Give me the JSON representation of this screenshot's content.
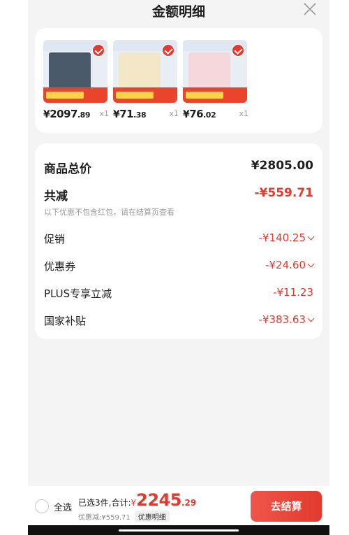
{
  "header": {
    "title": "金额明细",
    "close_icon": "close-icon"
  },
  "products": [
    {
      "price_currency": "¥",
      "price_int": "2097",
      "price_dec": ".89",
      "qty": "x1",
      "thumb_color": "#4a5a6a"
    },
    {
      "price_currency": "¥",
      "price_int": "71",
      "price_dec": ".38",
      "qty": "x1",
      "thumb_color": "#f3e7c8"
    },
    {
      "price_currency": "¥",
      "price_int": "76",
      "price_dec": ".02",
      "qty": "x1",
      "thumb_color": "#f6d8dc"
    }
  ],
  "summary": {
    "total_label": "商品总价",
    "total_value": "¥2805.00",
    "reduce_label": "共减",
    "reduce_value": "-¥559.71",
    "note": "以下优惠不包含红包，请在结算页查看",
    "items": [
      {
        "label": "促销",
        "value": "-¥140.25"
      },
      {
        "label": "优惠券",
        "value": "-¥24.60"
      },
      {
        "label": "PLUS专享立减",
        "value": "-¥11.23"
      },
      {
        "label": "国家补贴",
        "value": "-¥383.63"
      }
    ]
  },
  "bottom": {
    "select_all": "全选",
    "selected_text": "已选3件,合计:",
    "total_currency": "¥",
    "total_int": "2245",
    "total_dec": ".29",
    "saved_text": "优惠减:¥559.71",
    "detail_tag": "优惠明细",
    "checkout_label": "去结算"
  },
  "colors": {
    "accent": "#e23a2e",
    "background": "#f4f4f4",
    "card": "#ffffff"
  }
}
